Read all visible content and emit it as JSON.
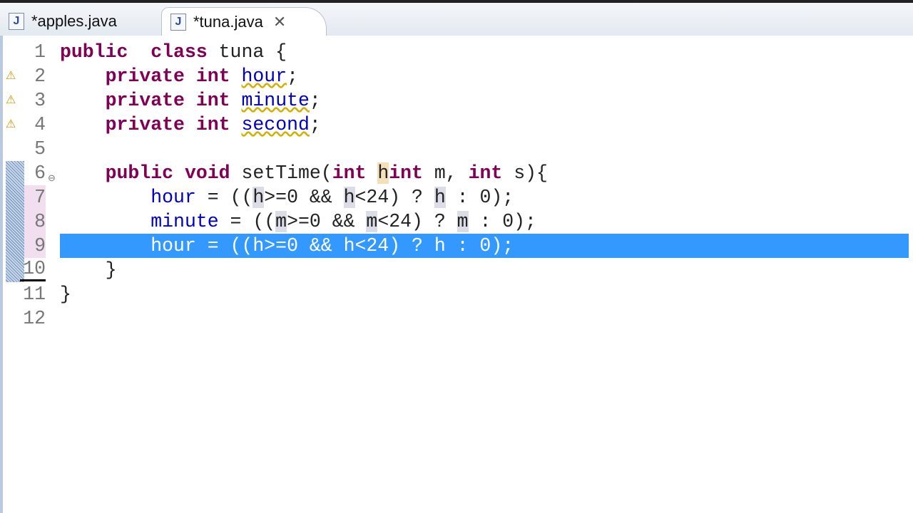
{
  "tabs": [
    {
      "label": "*apples.java",
      "icon": "java-file-icon",
      "active": false
    },
    {
      "label": "*tuna.java",
      "icon": "java-file-icon",
      "active": true
    }
  ],
  "code_lines": [
    {
      "n": "1",
      "tokens": [
        [
          "kw",
          "public"
        ],
        [
          "",
          "  "
        ],
        [
          "kw",
          "class"
        ],
        [
          "",
          " tuna {"
        ]
      ]
    },
    {
      "n": "2",
      "warn": true,
      "tokens": [
        [
          "",
          "    "
        ],
        [
          "kw",
          "private"
        ],
        [
          "",
          " "
        ],
        [
          "kw",
          "int"
        ],
        [
          "",
          " "
        ],
        [
          "fld warn",
          "hour"
        ],
        [
          "",
          ";"
        ]
      ]
    },
    {
      "n": "3",
      "warn": true,
      "tokens": [
        [
          "",
          "    "
        ],
        [
          "kw",
          "private"
        ],
        [
          "",
          " "
        ],
        [
          "kw",
          "int"
        ],
        [
          "",
          " "
        ],
        [
          "fld warn",
          "minute"
        ],
        [
          "",
          ";"
        ]
      ]
    },
    {
      "n": "4",
      "warn": true,
      "tokens": [
        [
          "",
          "    "
        ],
        [
          "kw",
          "private"
        ],
        [
          "",
          " "
        ],
        [
          "kw",
          "int"
        ],
        [
          "",
          " "
        ],
        [
          "fld warn",
          "second"
        ],
        [
          "",
          ";"
        ]
      ]
    },
    {
      "n": "5",
      "tokens": []
    },
    {
      "n": "6",
      "fold": true,
      "tokens": [
        [
          "",
          "    "
        ],
        [
          "kw",
          "public"
        ],
        [
          "",
          " "
        ],
        [
          "kw",
          "void"
        ],
        [
          "",
          " setTime("
        ],
        [
          "kw",
          "int"
        ],
        [
          "",
          " "
        ],
        [
          "occw",
          "h"
        ],
        [
          ", "
        ],
        [
          "kw",
          "int"
        ],
        [
          "",
          " m, "
        ],
        [
          "kw",
          "int"
        ],
        [
          "",
          " s){"
        ]
      ]
    },
    {
      "n": "7",
      "pink": true,
      "tokens": [
        [
          "",
          "        "
        ],
        [
          "fld",
          "hour"
        ],
        [
          "",
          " = (("
        ],
        [
          "occ",
          "h"
        ],
        [
          "",
          ">=0 && "
        ],
        [
          "occ",
          "h"
        ],
        [
          "",
          "<24) ? "
        ],
        [
          "occ",
          "h"
        ],
        [
          "",
          " : 0);"
        ]
      ]
    },
    {
      "n": "8",
      "pink": true,
      "tokens": [
        [
          "",
          "        "
        ],
        [
          "fld",
          "minute"
        ],
        [
          "",
          " = (("
        ],
        [
          "occ",
          "m"
        ],
        [
          "",
          ">=0 && "
        ],
        [
          "occ",
          "m"
        ],
        [
          "",
          "<24) ? "
        ],
        [
          "occ",
          "m"
        ],
        [
          "",
          " : 0);"
        ]
      ]
    },
    {
      "n": "9",
      "pink": true,
      "selected": true,
      "tokens": [
        [
          "",
          "        "
        ],
        [
          "fld",
          "hour"
        ],
        [
          "",
          " = ((h>=0 && h<24) ? h : 0);"
        ]
      ]
    },
    {
      "n": "10",
      "tokens": [
        [
          "",
          "    }"
        ]
      ]
    },
    {
      "n": "11",
      "tokens": [
        [
          "",
          "}"
        ]
      ]
    },
    {
      "n": "12",
      "tokens": []
    }
  ]
}
